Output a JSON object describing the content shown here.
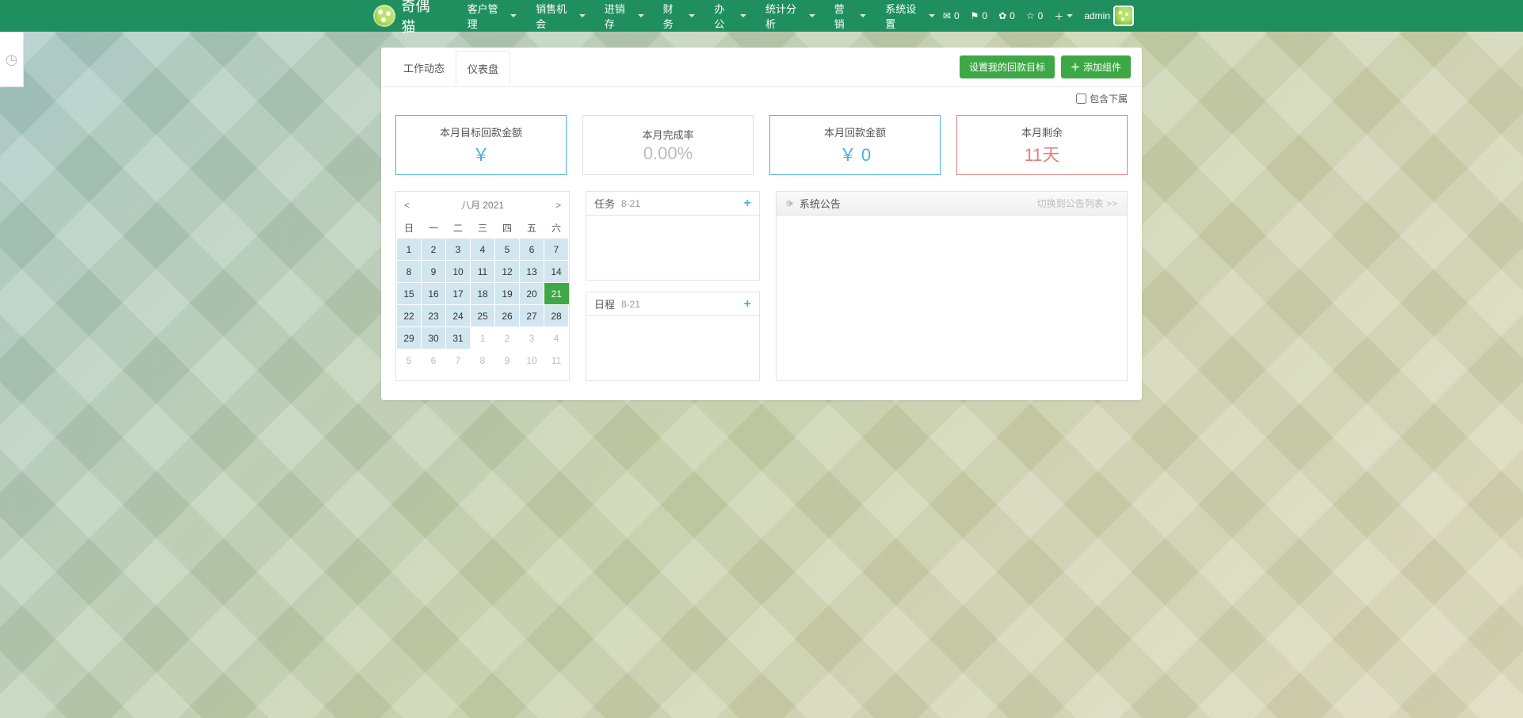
{
  "brand": "奇偶猫",
  "menu": [
    "客户管理",
    "销售机会",
    "进销存",
    "财 务",
    "办 公",
    "统计分析",
    "营 销",
    "系统设置"
  ],
  "navRight": {
    "mail": "0",
    "bell": "0",
    "gear": "0",
    "star": "0",
    "user": "admin"
  },
  "tabs": {
    "feed": "工作动态",
    "dash": "仪表盘"
  },
  "actions": {
    "goal": "设置我的回款目标",
    "addWidget": "添加组件"
  },
  "includeSubord": "包含下属",
  "cards": [
    {
      "title": "本月目标回款金额",
      "value": "￥"
    },
    {
      "title": "本月完成率",
      "value": "0.00%"
    },
    {
      "title": "本月回款金额",
      "value": "￥ 0"
    },
    {
      "title": "本月剩余",
      "value": "11天"
    }
  ],
  "calendar": {
    "title": "八月 2021",
    "dow": [
      "日",
      "一",
      "二",
      "三",
      "四",
      "五",
      "六"
    ],
    "weeks": [
      [
        {
          "d": 1,
          "t": "in"
        },
        {
          "d": 2,
          "t": "in"
        },
        {
          "d": 3,
          "t": "in"
        },
        {
          "d": 4,
          "t": "in"
        },
        {
          "d": 5,
          "t": "in"
        },
        {
          "d": 6,
          "t": "in"
        },
        {
          "d": 7,
          "t": "in"
        }
      ],
      [
        {
          "d": 8,
          "t": "in"
        },
        {
          "d": 9,
          "t": "in"
        },
        {
          "d": 10,
          "t": "in"
        },
        {
          "d": 11,
          "t": "in"
        },
        {
          "d": 12,
          "t": "in"
        },
        {
          "d": 13,
          "t": "in"
        },
        {
          "d": 14,
          "t": "in"
        }
      ],
      [
        {
          "d": 15,
          "t": "in"
        },
        {
          "d": 16,
          "t": "in"
        },
        {
          "d": 17,
          "t": "in"
        },
        {
          "d": 18,
          "t": "in"
        },
        {
          "d": 19,
          "t": "in"
        },
        {
          "d": 20,
          "t": "in"
        },
        {
          "d": 21,
          "t": "today"
        }
      ],
      [
        {
          "d": 22,
          "t": "in"
        },
        {
          "d": 23,
          "t": "in"
        },
        {
          "d": 24,
          "t": "in"
        },
        {
          "d": 25,
          "t": "in"
        },
        {
          "d": 26,
          "t": "in"
        },
        {
          "d": 27,
          "t": "in"
        },
        {
          "d": 28,
          "t": "in"
        }
      ],
      [
        {
          "d": 29,
          "t": "in"
        },
        {
          "d": 30,
          "t": "in"
        },
        {
          "d": 31,
          "t": "in"
        },
        {
          "d": 1,
          "t": "out"
        },
        {
          "d": 2,
          "t": "out"
        },
        {
          "d": 3,
          "t": "out"
        },
        {
          "d": 4,
          "t": "out"
        }
      ],
      [
        {
          "d": 5,
          "t": "out"
        },
        {
          "d": 6,
          "t": "out"
        },
        {
          "d": 7,
          "t": "out"
        },
        {
          "d": 8,
          "t": "out"
        },
        {
          "d": 9,
          "t": "out"
        },
        {
          "d": 10,
          "t": "out"
        },
        {
          "d": 11,
          "t": "out"
        }
      ]
    ]
  },
  "task": {
    "title": "任务",
    "date": "8-21"
  },
  "sched": {
    "title": "日程",
    "date": "8-21"
  },
  "announce": {
    "title": "系统公告",
    "switch": "切换到公告列表 >>"
  }
}
